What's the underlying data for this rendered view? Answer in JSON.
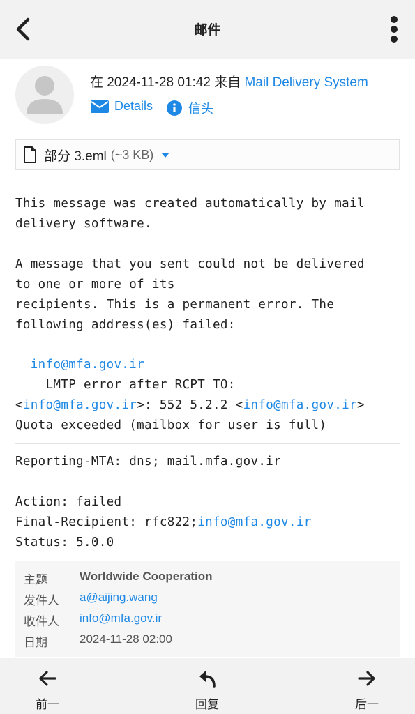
{
  "topbar": {
    "title": "邮件"
  },
  "message": {
    "prefix": "在 2024-11-28 01:42 来自",
    "sender": "Mail Delivery System",
    "details_label": "Details",
    "headers_label": "信头"
  },
  "attachment": {
    "name": "部分 3.eml",
    "size": "(~3 KB)"
  },
  "body": {
    "p1": [
      "This message was created automatically by mail",
      "delivery software."
    ],
    "p2": [
      "A message that you sent could not be delivered",
      "to one or more of its",
      "recipients. This is a permanent error. The",
      "following address(es) failed:"
    ],
    "failed_address": "info@mfa.gov.ir",
    "lmtp_line": "LMTP error after RCPT TO:",
    "err_lt": "<",
    "err_addr1": "info@mfa.gov.ir",
    "err_mid": ">: 552 5.2.2 <",
    "err_addr2": "info@mfa.gov.ir",
    "err_gt": ">",
    "quota_line": "Quota exceeded (mailbox for user is full)",
    "reporting_mta": "Reporting-MTA: dns; mail.mfa.gov.ir",
    "action": "Action: failed",
    "final_prefix": "Final-Recipient: rfc822;",
    "final_addr": "info@mfa.gov.ir",
    "status": "Status: 5.0.0"
  },
  "headers": {
    "subject_key": "主题",
    "subject": "Worldwide Cooperation",
    "from_key": "发件人",
    "from": "a@aijing.wang",
    "to_key": "收件人",
    "to": "info@mfa.gov.ir",
    "date_key": "日期",
    "date": "2024-11-28 02:00"
  },
  "bottom": {
    "prev": "前一",
    "reply": "回复",
    "next": "后一"
  },
  "colors": {
    "link": "#1e88e5",
    "bar": "#f2f2f2"
  },
  "icons": [
    "back-arrow-icon",
    "more-vertical-icon",
    "avatar-icon",
    "envelope-icon",
    "info-icon",
    "file-icon",
    "caret-down-icon",
    "arrow-left-icon",
    "reply-icon",
    "arrow-right-icon"
  ]
}
